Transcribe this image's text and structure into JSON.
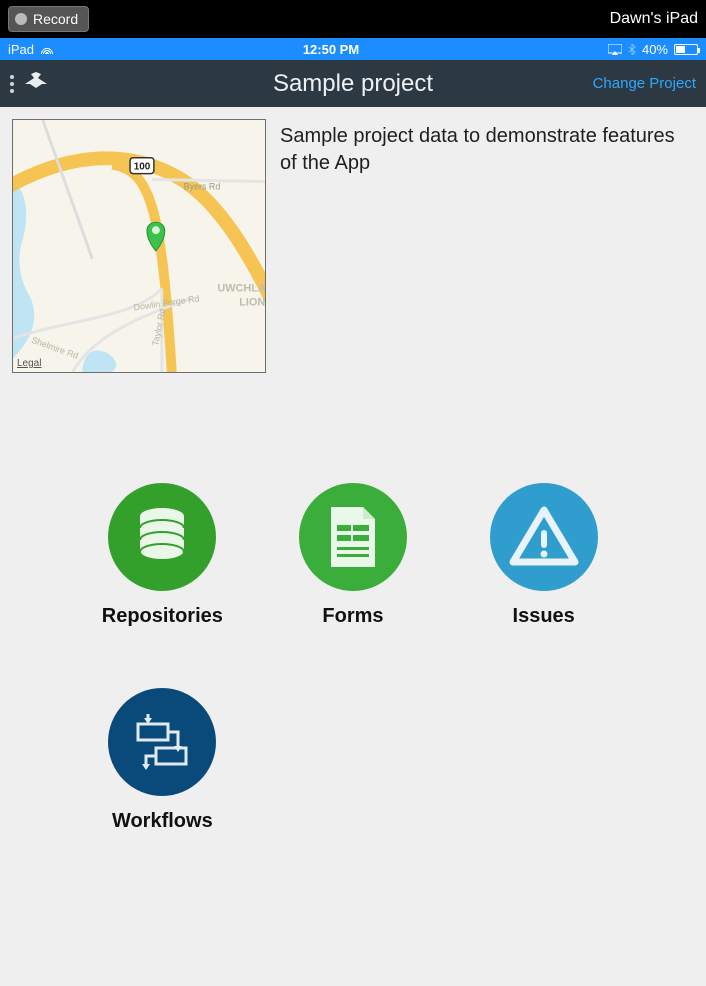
{
  "system": {
    "record_label": "Record",
    "device_name": "Dawn's iPad"
  },
  "status": {
    "carrier": "iPad",
    "time": "12:50 PM",
    "battery_pct": "40%"
  },
  "nav": {
    "title": "Sample project",
    "change_project_label": "Change Project"
  },
  "project": {
    "description": "Sample project data to demonstrate features of the App",
    "map_legal": "Legal",
    "map_labels": {
      "route_badge": "100",
      "road1": "Byers Rd",
      "road2": "Dowlin Forge Rd",
      "road3": "Shelmire Rd",
      "road4": "Taylor Rd",
      "area1": "UWCHLAN",
      "area2": "LIONV"
    }
  },
  "tiles": [
    {
      "label": "Repositories",
      "icon": "database-icon",
      "color": "c-green"
    },
    {
      "label": "Forms",
      "icon": "form-icon",
      "color": "c-green2"
    },
    {
      "label": "Issues",
      "icon": "warning-icon",
      "color": "c-blue"
    },
    {
      "label": "Workflows",
      "icon": "workflow-icon",
      "color": "c-navy"
    }
  ]
}
